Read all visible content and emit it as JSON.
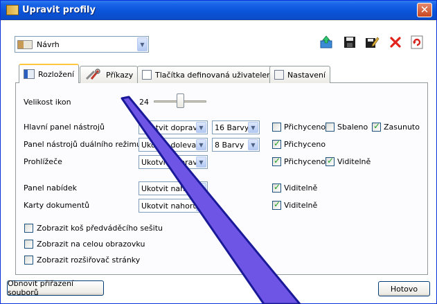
{
  "window": {
    "title": "Upravit profily",
    "close_label": "✕"
  },
  "profile": {
    "selected": "Návrh"
  },
  "toolbar_icons": [
    "upload-icon",
    "save-icon",
    "save-as-icon",
    "delete-icon",
    "refresh-icon"
  ],
  "tabs": [
    {
      "label": "Rozložení",
      "active": true
    },
    {
      "label": "Příkazy",
      "active": false
    },
    {
      "label": "Tlačítka definovaná uživatelem",
      "active": false
    },
    {
      "label": "Nastavení",
      "active": false
    }
  ],
  "icon_size": {
    "label": "Velikost ikon",
    "value": "24"
  },
  "rows": {
    "main_toolbar": {
      "label": "Hlavní panel nástrojů",
      "position": "Ukotvit doprava",
      "colors": "16 Barvy",
      "attached_label": "Přichyceno",
      "attached": false,
      "collapsed_label": "Sbaleno",
      "collapsed": false,
      "inserted_label": "Zasunuto",
      "inserted": true
    },
    "dual_toolbar": {
      "label": "Panel nástrojů duálního režimu",
      "position": "Ukotvit doleva",
      "colors": "8 Barvy",
      "attached_label": "Přichyceno",
      "attached": true
    },
    "viewers": {
      "label": "Prohlížeče",
      "position": "Ukotvit doprava",
      "attached_label": "Přichyceno",
      "attached": true,
      "visible_label": "Viditelně",
      "visible": true
    },
    "menu_bar": {
      "label": "Panel nabídek",
      "position": "Ukotvit nahoru",
      "visible_label": "Viditelně",
      "visible": true
    },
    "doc_cards": {
      "label": "Karty dokumentů",
      "position": "Ukotvit nahoru",
      "visible_label": "Viditelně",
      "visible": true
    }
  },
  "options": [
    {
      "label": "Zobrazit koš předváděcího sešitu",
      "checked": false
    },
    {
      "label": "Zobrazit na celou obrazovku",
      "checked": false
    },
    {
      "label": "Zobrazit rozšiřovač stránky",
      "checked": false
    }
  ],
  "footer": {
    "reset_label": "Obnovit přiřazení souborů",
    "done_label": "Hotovo"
  },
  "colors": {
    "titlebar": "#0a53d8",
    "close": "#c84720",
    "tab_accent": "#ffc83c",
    "check": "#21a121",
    "pointer_stroke": "#1a1a99",
    "pointer_fill": "#6e55e6"
  }
}
